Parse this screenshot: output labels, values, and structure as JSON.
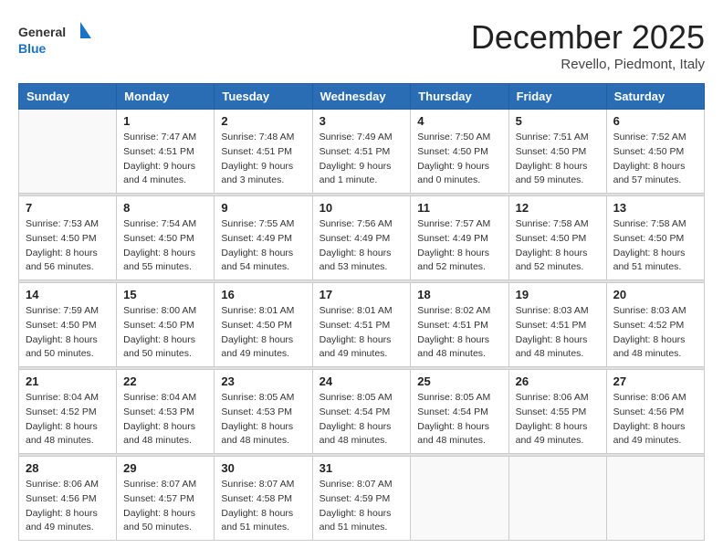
{
  "logo": {
    "text_general": "General",
    "text_blue": "Blue"
  },
  "title": {
    "month_year": "December 2025",
    "location": "Revello, Piedmont, Italy"
  },
  "weekdays": [
    "Sunday",
    "Monday",
    "Tuesday",
    "Wednesday",
    "Thursday",
    "Friday",
    "Saturday"
  ],
  "weeks": [
    [
      {
        "day": "",
        "info": ""
      },
      {
        "day": "1",
        "info": "Sunrise: 7:47 AM\nSunset: 4:51 PM\nDaylight: 9 hours\nand 4 minutes."
      },
      {
        "day": "2",
        "info": "Sunrise: 7:48 AM\nSunset: 4:51 PM\nDaylight: 9 hours\nand 3 minutes."
      },
      {
        "day": "3",
        "info": "Sunrise: 7:49 AM\nSunset: 4:51 PM\nDaylight: 9 hours\nand 1 minute."
      },
      {
        "day": "4",
        "info": "Sunrise: 7:50 AM\nSunset: 4:50 PM\nDaylight: 9 hours\nand 0 minutes."
      },
      {
        "day": "5",
        "info": "Sunrise: 7:51 AM\nSunset: 4:50 PM\nDaylight: 8 hours\nand 59 minutes."
      },
      {
        "day": "6",
        "info": "Sunrise: 7:52 AM\nSunset: 4:50 PM\nDaylight: 8 hours\nand 57 minutes."
      }
    ],
    [
      {
        "day": "7",
        "info": "Sunrise: 7:53 AM\nSunset: 4:50 PM\nDaylight: 8 hours\nand 56 minutes."
      },
      {
        "day": "8",
        "info": "Sunrise: 7:54 AM\nSunset: 4:50 PM\nDaylight: 8 hours\nand 55 minutes."
      },
      {
        "day": "9",
        "info": "Sunrise: 7:55 AM\nSunset: 4:49 PM\nDaylight: 8 hours\nand 54 minutes."
      },
      {
        "day": "10",
        "info": "Sunrise: 7:56 AM\nSunset: 4:49 PM\nDaylight: 8 hours\nand 53 minutes."
      },
      {
        "day": "11",
        "info": "Sunrise: 7:57 AM\nSunset: 4:49 PM\nDaylight: 8 hours\nand 52 minutes."
      },
      {
        "day": "12",
        "info": "Sunrise: 7:58 AM\nSunset: 4:50 PM\nDaylight: 8 hours\nand 52 minutes."
      },
      {
        "day": "13",
        "info": "Sunrise: 7:58 AM\nSunset: 4:50 PM\nDaylight: 8 hours\nand 51 minutes."
      }
    ],
    [
      {
        "day": "14",
        "info": "Sunrise: 7:59 AM\nSunset: 4:50 PM\nDaylight: 8 hours\nand 50 minutes."
      },
      {
        "day": "15",
        "info": "Sunrise: 8:00 AM\nSunset: 4:50 PM\nDaylight: 8 hours\nand 50 minutes."
      },
      {
        "day": "16",
        "info": "Sunrise: 8:01 AM\nSunset: 4:50 PM\nDaylight: 8 hours\nand 49 minutes."
      },
      {
        "day": "17",
        "info": "Sunrise: 8:01 AM\nSunset: 4:51 PM\nDaylight: 8 hours\nand 49 minutes."
      },
      {
        "day": "18",
        "info": "Sunrise: 8:02 AM\nSunset: 4:51 PM\nDaylight: 8 hours\nand 48 minutes."
      },
      {
        "day": "19",
        "info": "Sunrise: 8:03 AM\nSunset: 4:51 PM\nDaylight: 8 hours\nand 48 minutes."
      },
      {
        "day": "20",
        "info": "Sunrise: 8:03 AM\nSunset: 4:52 PM\nDaylight: 8 hours\nand 48 minutes."
      }
    ],
    [
      {
        "day": "21",
        "info": "Sunrise: 8:04 AM\nSunset: 4:52 PM\nDaylight: 8 hours\nand 48 minutes."
      },
      {
        "day": "22",
        "info": "Sunrise: 8:04 AM\nSunset: 4:53 PM\nDaylight: 8 hours\nand 48 minutes."
      },
      {
        "day": "23",
        "info": "Sunrise: 8:05 AM\nSunset: 4:53 PM\nDaylight: 8 hours\nand 48 minutes."
      },
      {
        "day": "24",
        "info": "Sunrise: 8:05 AM\nSunset: 4:54 PM\nDaylight: 8 hours\nand 48 minutes."
      },
      {
        "day": "25",
        "info": "Sunrise: 8:05 AM\nSunset: 4:54 PM\nDaylight: 8 hours\nand 48 minutes."
      },
      {
        "day": "26",
        "info": "Sunrise: 8:06 AM\nSunset: 4:55 PM\nDaylight: 8 hours\nand 49 minutes."
      },
      {
        "day": "27",
        "info": "Sunrise: 8:06 AM\nSunset: 4:56 PM\nDaylight: 8 hours\nand 49 minutes."
      }
    ],
    [
      {
        "day": "28",
        "info": "Sunrise: 8:06 AM\nSunset: 4:56 PM\nDaylight: 8 hours\nand 49 minutes."
      },
      {
        "day": "29",
        "info": "Sunrise: 8:07 AM\nSunset: 4:57 PM\nDaylight: 8 hours\nand 50 minutes."
      },
      {
        "day": "30",
        "info": "Sunrise: 8:07 AM\nSunset: 4:58 PM\nDaylight: 8 hours\nand 51 minutes."
      },
      {
        "day": "31",
        "info": "Sunrise: 8:07 AM\nSunset: 4:59 PM\nDaylight: 8 hours\nand 51 minutes."
      },
      {
        "day": "",
        "info": ""
      },
      {
        "day": "",
        "info": ""
      },
      {
        "day": "",
        "info": ""
      }
    ]
  ]
}
